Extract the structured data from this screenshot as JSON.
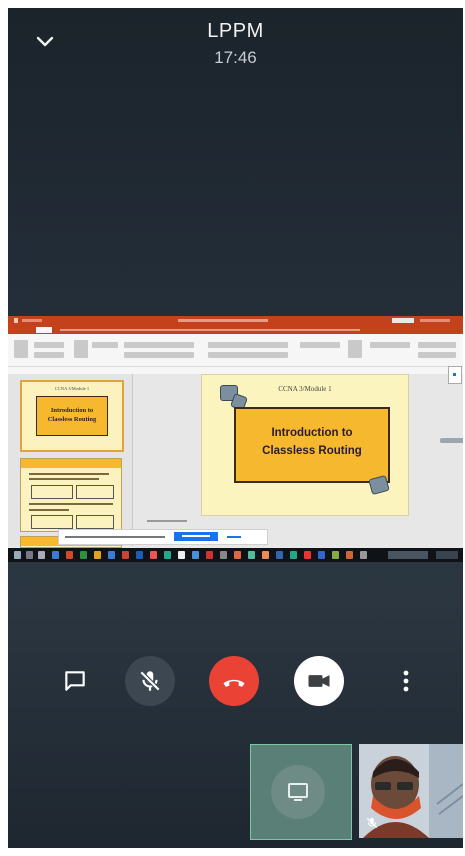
{
  "call": {
    "title": "LPPM",
    "time": "17:46"
  },
  "icons": {
    "collapse": "chevron-down-icon",
    "chat": "chat-icon",
    "mic": "mic-off-icon",
    "end_call": "call-end-icon",
    "camera": "videocam-icon",
    "more": "more-vert-icon",
    "present": "present-screen-icon",
    "self_mic": "mic-off-icon"
  },
  "colors": {
    "end_call": "#ea4335",
    "mic_button": "#3c4752",
    "camera_button": "#ffffff",
    "present_tile": "#597f76",
    "ribbon": "#c4411d",
    "slide_bg": "#fbf4bf",
    "title_box": "#f5b82e",
    "share_button": "#1a73e8"
  },
  "shared_screen": {
    "thumbnails": [
      {
        "header": "CCNA 3/Module 1",
        "title_line1": "Introduction to",
        "title_line2": "Classless Routing"
      }
    ],
    "main_slide": {
      "header": "CCNA 3/Module 1",
      "title_line1": "Introduction to",
      "title_line2": "Classless Routing"
    }
  }
}
